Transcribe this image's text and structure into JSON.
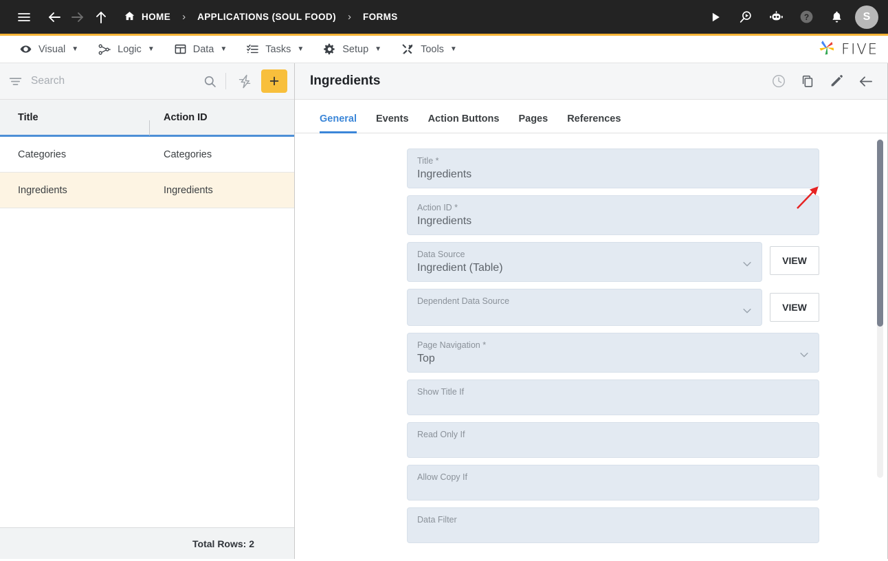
{
  "topbar": {
    "menu_icon": "hamburger-icon",
    "back_icon": "arrow-left-icon",
    "forward_icon": "arrow-right-icon",
    "up_icon": "arrow-up-icon",
    "breadcrumbs": [
      {
        "label": "HOME",
        "icon": "home-icon"
      },
      {
        "label": "APPLICATIONS (SOUL FOOD)",
        "icon": ""
      },
      {
        "label": "FORMS",
        "icon": ""
      }
    ],
    "separator": "›",
    "actions": [
      {
        "name": "run-icon",
        "glyph": "play"
      },
      {
        "name": "search-play-icon",
        "glyph": "searchplay"
      },
      {
        "name": "chat-bot-icon",
        "glyph": "bot"
      },
      {
        "name": "help-icon",
        "glyph": "question"
      },
      {
        "name": "notifications-bell-icon",
        "glyph": "bell"
      }
    ],
    "avatar_initial": "S",
    "accent_color": "#f5b335",
    "background_color": "#232323"
  },
  "menubar": {
    "items": [
      {
        "label": "Visual",
        "icon": "eye-icon",
        "caret": "▼"
      },
      {
        "label": "Logic",
        "icon": "logic-nodes-icon",
        "caret": "▼"
      },
      {
        "label": "Data",
        "icon": "table-grid-icon",
        "caret": "▼"
      },
      {
        "label": "Tasks",
        "icon": "checklist-icon",
        "caret": "▼"
      },
      {
        "label": "Setup",
        "icon": "gear-icon",
        "caret": "▼"
      },
      {
        "label": "Tools",
        "icon": "tools-icon",
        "caret": "▼"
      }
    ],
    "brand": "FIVE"
  },
  "left_panel": {
    "search": {
      "placeholder": "Search",
      "value": ""
    },
    "filter_icon": "filter-icon",
    "search_icon": "search-icon",
    "bolt_icon": "lightning-bolt-icon",
    "add_label": "+",
    "columns": [
      "Title",
      "Action ID"
    ],
    "rows": [
      {
        "title": "Categories",
        "action_id": "Categories",
        "selected": false
      },
      {
        "title": "Ingredients",
        "action_id": "Ingredients",
        "selected": true
      }
    ],
    "footer": "Total Rows: 2",
    "selected_row_color": "#fdf4e3",
    "header_underline_color": "#4d8fd6"
  },
  "content": {
    "title": "Ingredients",
    "header_icons": [
      {
        "name": "history-clock-icon"
      },
      {
        "name": "copy-icon"
      },
      {
        "name": "edit-pencil-icon"
      },
      {
        "name": "back-arrow-icon"
      }
    ],
    "tabs": [
      {
        "label": "General",
        "active": true
      },
      {
        "label": "Events",
        "active": false
      },
      {
        "label": "Action Buttons",
        "active": false
      },
      {
        "label": "Pages",
        "active": false
      },
      {
        "label": "References",
        "active": false
      }
    ],
    "active_tab_color": "#3b86d8",
    "fields": [
      {
        "label": "Title *",
        "value": "Ingredients",
        "type": "text",
        "button": ""
      },
      {
        "label": "Action ID *",
        "value": "Ingredients",
        "type": "text",
        "button": ""
      },
      {
        "label": "Data Source",
        "value": "Ingredient (Table)",
        "type": "select",
        "button": "VIEW"
      },
      {
        "label": "Dependent Data Source",
        "value": "",
        "type": "select",
        "button": "VIEW"
      },
      {
        "label": "Page Navigation *",
        "value": "Top",
        "type": "select",
        "button": ""
      },
      {
        "label": "Show Title If",
        "value": "",
        "type": "text",
        "button": ""
      },
      {
        "label": "Read Only If",
        "value": "",
        "type": "text",
        "button": ""
      },
      {
        "label": "Allow Copy If",
        "value": "",
        "type": "text",
        "button": ""
      },
      {
        "label": "Data Filter",
        "value": "",
        "type": "text",
        "button": ""
      }
    ],
    "scrollbar": {
      "name": "vertical-scrollbar"
    }
  },
  "annotation": {
    "name": "red-arrow-annotation",
    "color": "#e62222",
    "points_to": "Pages"
  }
}
